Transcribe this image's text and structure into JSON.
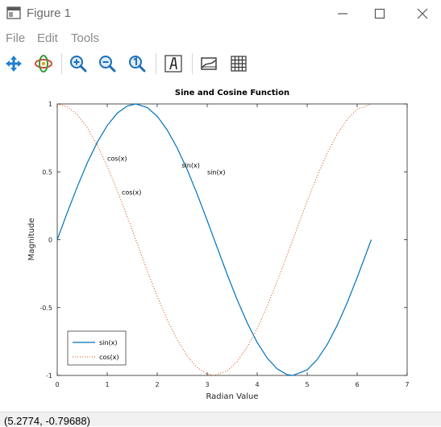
{
  "window": {
    "title": "Figure 1",
    "minimize_icon": "minimize-icon",
    "maximize_icon": "maximize-icon",
    "close_icon": "close-icon"
  },
  "menubar": {
    "items": [
      {
        "label": "File"
      },
      {
        "label": "Edit"
      },
      {
        "label": "Tools"
      }
    ]
  },
  "toolbar": {
    "tools": [
      {
        "icon": "pan-icon"
      },
      {
        "icon": "rotate-icon"
      },
      {
        "icon": "zoom-in-icon"
      },
      {
        "icon": "zoom-out-icon"
      },
      {
        "icon": "zoom-reset-icon"
      },
      {
        "icon": "insert-text-icon"
      },
      {
        "icon": "toggle-axes-icon"
      },
      {
        "icon": "toggle-grid-icon"
      }
    ]
  },
  "chart_data": {
    "type": "line",
    "title": "Sine and Cosine Function",
    "xlabel": "Radian Value",
    "ylabel": "Magnitude",
    "xlim": [
      0,
      7
    ],
    "ylim": [
      -1,
      1
    ],
    "xticks": [
      "0",
      "1",
      "2",
      "3",
      "4",
      "5",
      "6",
      "7"
    ],
    "yticks": [
      "1",
      "0.5",
      "0",
      "-0.5",
      "-1"
    ],
    "grid": false,
    "legend_position": "bottom-left",
    "series": [
      {
        "name": "sin(x)",
        "color": "#0072bd",
        "style": "solid",
        "x": [
          0,
          0.2,
          0.4,
          0.6,
          0.8,
          1.0,
          1.2,
          1.4,
          1.571,
          1.8,
          2.0,
          2.2,
          2.4,
          2.6,
          2.8,
          3.0,
          3.2,
          3.4,
          3.6,
          3.8,
          4.0,
          4.2,
          4.4,
          4.6,
          4.712,
          5.0,
          5.2,
          5.4,
          5.6,
          5.8,
          6.0,
          6.283
        ],
        "y": [
          0,
          0.199,
          0.389,
          0.565,
          0.717,
          0.841,
          0.932,
          0.985,
          1.0,
          0.974,
          0.909,
          0.808,
          0.675,
          0.516,
          0.335,
          0.141,
          -0.058,
          -0.256,
          -0.443,
          -0.612,
          -0.757,
          -0.872,
          -0.952,
          -0.994,
          -1.0,
          -0.959,
          -0.883,
          -0.773,
          -0.631,
          -0.465,
          -0.279,
          0.0
        ]
      },
      {
        "name": "cos(x)",
        "color": "#d95319",
        "style": "dotted",
        "x": [
          0,
          0.2,
          0.4,
          0.6,
          0.8,
          1.0,
          1.2,
          1.4,
          1.6,
          1.8,
          2.0,
          2.2,
          2.4,
          2.6,
          2.8,
          3.0,
          3.142,
          3.4,
          3.6,
          3.8,
          4.0,
          4.2,
          4.4,
          4.6,
          4.8,
          5.0,
          5.2,
          5.4,
          5.6,
          5.8,
          6.0,
          6.283
        ],
        "y": [
          1.0,
          0.98,
          0.921,
          0.825,
          0.697,
          0.54,
          0.362,
          0.17,
          -0.029,
          -0.227,
          -0.416,
          -0.589,
          -0.737,
          -0.857,
          -0.942,
          -0.99,
          -1.0,
          -0.967,
          -0.897,
          -0.791,
          -0.654,
          -0.49,
          -0.307,
          -0.112,
          0.087,
          0.284,
          0.469,
          0.635,
          0.776,
          0.886,
          0.96,
          1.0
        ]
      }
    ],
    "annotations": [
      {
        "text": "cos(x)",
        "x": 1.0,
        "y": 0.6
      },
      {
        "text": "cos(x)",
        "x": 1.29,
        "y": 0.35
      },
      {
        "text": "sin(x)",
        "x": 2.49,
        "y": 0.55
      },
      {
        "text": "sin(x)",
        "x": 3.0,
        "y": 0.5
      }
    ]
  },
  "status": {
    "coordinates": "(5.2774, -0.79688)"
  }
}
